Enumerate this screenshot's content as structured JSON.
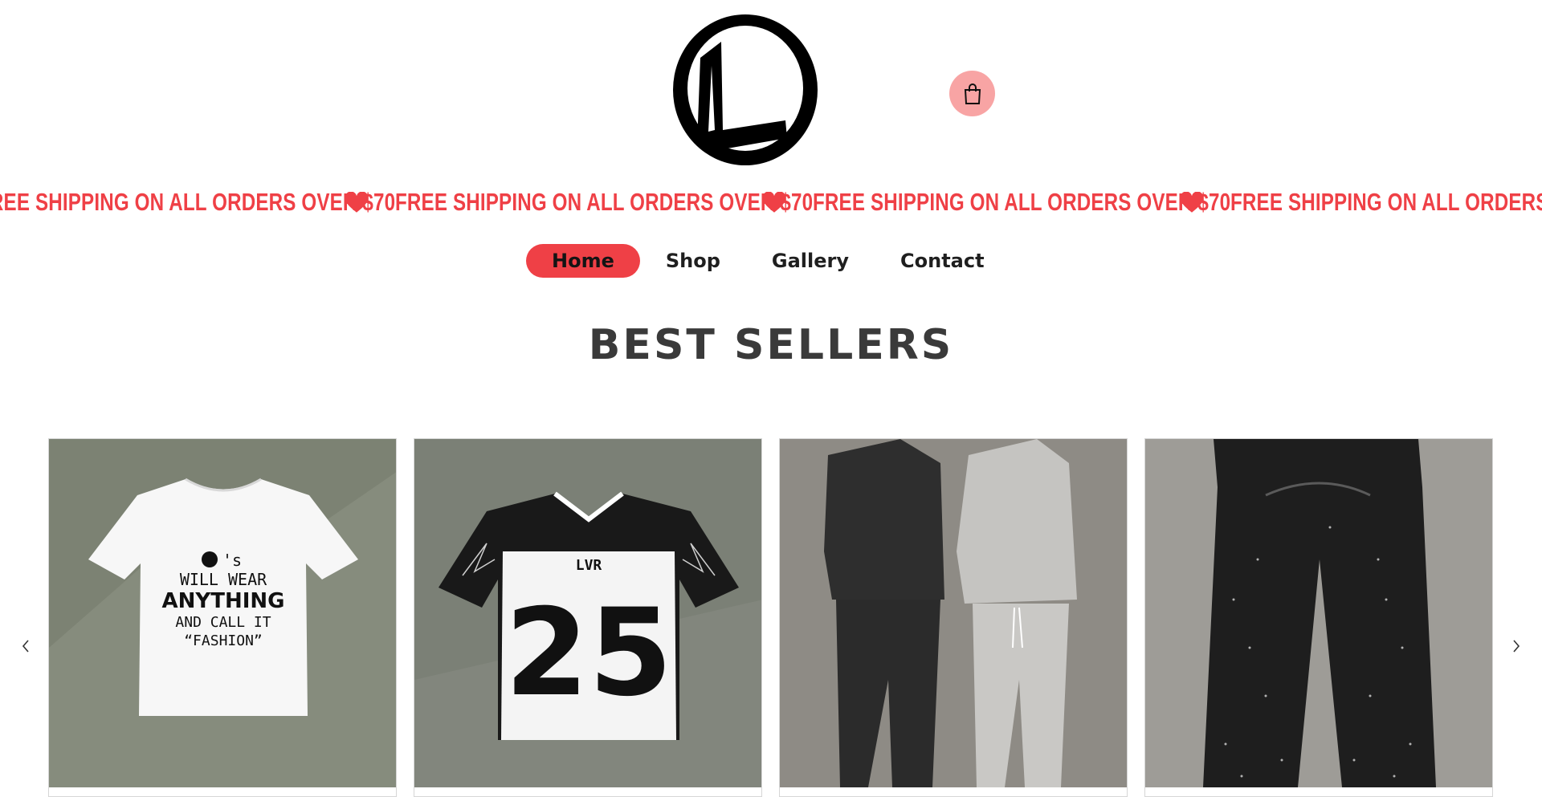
{
  "header": {
    "logo_icon": "brand-logo-letter-l",
    "cart_icon": "shopping-bag-icon",
    "cart_color": "#f8a4a4"
  },
  "announcement": {
    "text": "FREE SHIPPING ON ALL ORDERS OVER $70",
    "icon": "heart-icon",
    "color": "#ef4046"
  },
  "nav": {
    "items": [
      {
        "label": "Home",
        "active": true
      },
      {
        "label": "Shop",
        "active": false
      },
      {
        "label": "Gallery",
        "active": false
      },
      {
        "label": "Contact",
        "active": false
      }
    ],
    "accent": "#ef4046"
  },
  "best_sellers": {
    "title": "BEST SELLERS",
    "products": [
      {
        "graphic_lines": [
          "'s",
          "WILL WEAR",
          "ANYTHING",
          "AND CALL IT",
          "“FASHION”"
        ]
      },
      {
        "graphic_text": "LVR",
        "graphic_number": "25"
      },
      {},
      {}
    ]
  }
}
